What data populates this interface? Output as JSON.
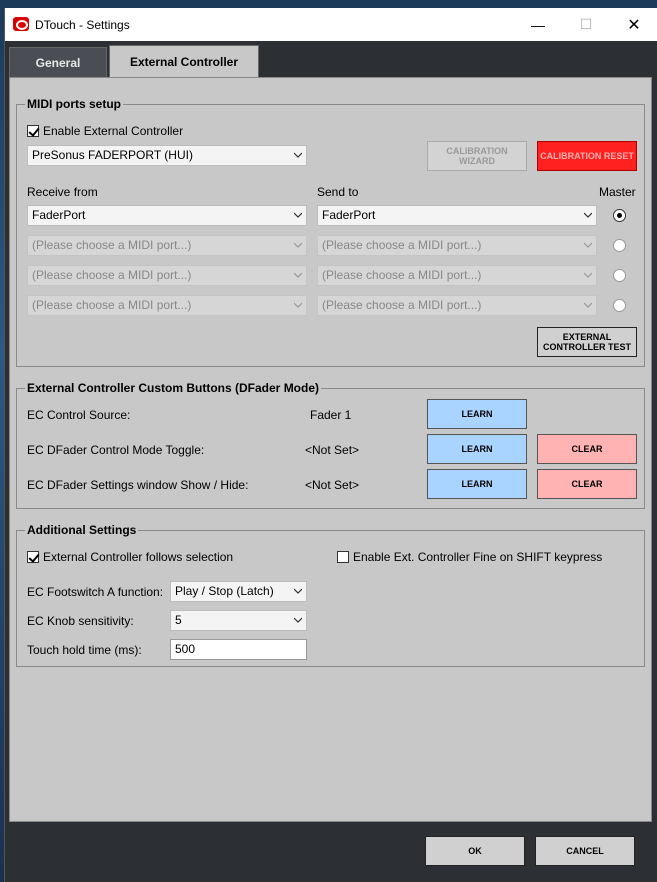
{
  "window": {
    "title": "DTouch - Settings",
    "minimize": "—",
    "maximize": "☐",
    "close": "✕"
  },
  "tabs": [
    {
      "label": "General",
      "active": false
    },
    {
      "label": "External Controller",
      "active": true
    }
  ],
  "midi": {
    "title": "MIDI ports setup",
    "enable_label": "Enable External Controller",
    "enable_checked": true,
    "controller": "PreSonus FADERPORT (HUI)",
    "calibration_wizard": "CALIBRATION WIZARD",
    "calibration_reset": "CALIBRATION RESET",
    "receive_header": "Receive from",
    "send_header": "Send to",
    "master_header": "Master",
    "rows": [
      {
        "receive": "FaderPort",
        "send": "FaderPort",
        "master": true,
        "disabled": false
      },
      {
        "receive": "(Please choose a MIDI port...)",
        "send": "(Please choose a MIDI port...)",
        "master": false,
        "disabled": true
      },
      {
        "receive": "(Please choose a MIDI port...)",
        "send": "(Please choose a MIDI port...)",
        "master": false,
        "disabled": true
      },
      {
        "receive": "(Please choose a MIDI port...)",
        "send": "(Please choose a MIDI port...)",
        "master": false,
        "disabled": true
      }
    ],
    "test_button": "EXTERNAL CONTROLLER TEST"
  },
  "custom": {
    "title": "External Controller Custom Buttons (DFader Mode)",
    "rows": [
      {
        "label": "EC Control Source:",
        "value": "Fader 1",
        "learn": "LEARN",
        "clear": ""
      },
      {
        "label": "EC DFader Control Mode Toggle:",
        "value": "<Not Set>",
        "learn": "LEARN",
        "clear": "CLEAR"
      },
      {
        "label": "EC DFader Settings window Show / Hide:",
        "value": "<Not Set>",
        "learn": "LEARN",
        "clear": "CLEAR"
      }
    ]
  },
  "additional": {
    "title": "Additional Settings",
    "follows_label": "External Controller follows selection",
    "follows_checked": true,
    "fine_label": "Enable Ext. Controller Fine on SHIFT keypress",
    "fine_checked": false,
    "footswitch_label": "EC Footswitch A function:",
    "footswitch_value": "Play / Stop (Latch)",
    "knob_label": "EC Knob sensitivity:",
    "knob_value": "5",
    "hold_label": "Touch hold time (ms):",
    "hold_value": "500"
  },
  "footer": {
    "ok": "OK",
    "cancel": "CANCEL"
  }
}
